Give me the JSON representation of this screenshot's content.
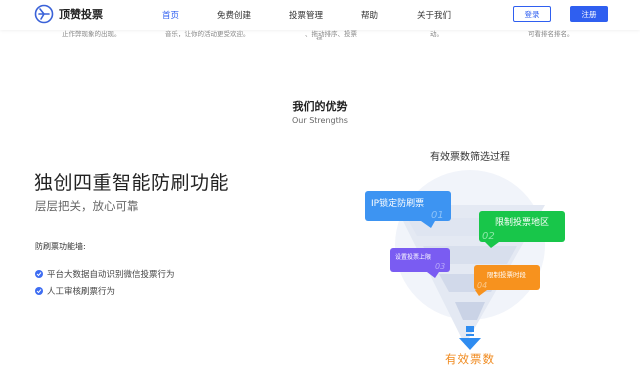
{
  "header": {
    "logo_text": "顶赞投票",
    "nav": [
      "首页",
      "免费创建",
      "投票管理",
      "帮助",
      "关于我们"
    ],
    "login_label": "登录",
    "register_label": "注册"
  },
  "cut_row": [
    "止作弊现象的出现。",
    "音乐，让你的活动更受欢迎。",
    "、拖动排序、投票",
    "墙。",
    "动。",
    "可看排名排名。"
  ],
  "section": {
    "title": "我们的优势",
    "subtitle": "Our Strengths"
  },
  "feature": {
    "headline": "独创四重智能防刷功能",
    "subline": "层层把关，放心可靠",
    "func_label": "防刷票功能墙:",
    "items": [
      "平台大数据自动识别微信投票行为",
      "人工审核刷票行为"
    ]
  },
  "diagram": {
    "title": "有效票数筛选过程",
    "steps": [
      {
        "label": "IP锁定防刷票",
        "num": "01"
      },
      {
        "label": "限制投票地区",
        "num": "02"
      },
      {
        "label": "设置投票上限",
        "num": "03"
      },
      {
        "label": "限制投票时段",
        "num": "04"
      }
    ],
    "result": "有效票数"
  },
  "colors": {
    "accent": "#2f5ff0",
    "step1": "#3d94f2",
    "step2": "#18c64a",
    "step3": "#7a5cf2",
    "step4": "#f7921e",
    "result": "#f08a1e"
  },
  "icons": {
    "logo": "logo-circle-icon",
    "check": "check-circle-icon",
    "arrow": "arrow-down-icon"
  }
}
